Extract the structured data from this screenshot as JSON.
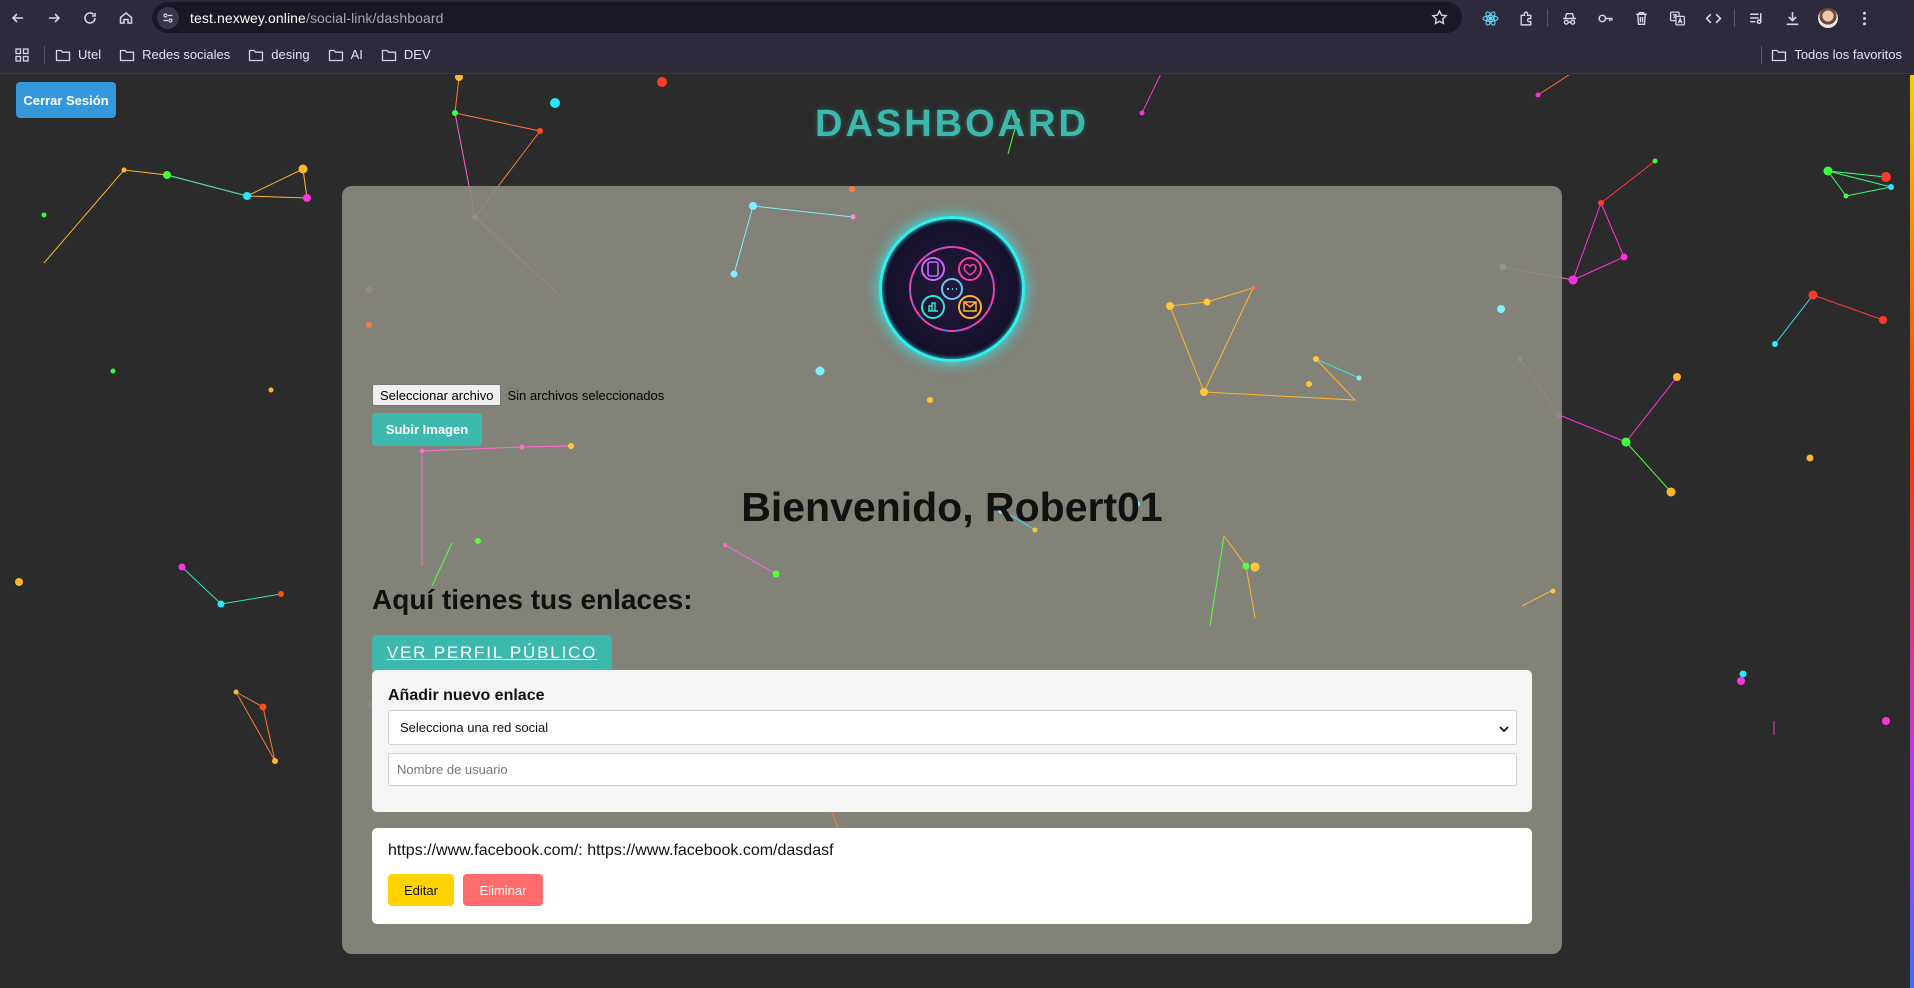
{
  "browser": {
    "url_host": "test.nexwey.online",
    "url_path": "/social-link/dashboard",
    "bookmarks": [
      "Utel",
      "Redes sociales",
      "desing",
      "AI",
      "DEV"
    ],
    "all_bookmarks_label": "Todos los favoritos"
  },
  "page": {
    "logout_label": "Cerrar Sesión",
    "title": "DASHBOARD",
    "file_button_label": "Seleccionar archivo",
    "file_status": "Sin archivos seleccionados",
    "upload_label": "Subir Imagen",
    "welcome": "Bienvenido, Robert01",
    "links_heading": "Aquí tienes tus enlaces:",
    "public_profile_label": "VER PERFIL PÚBLICO",
    "add_link": {
      "title": "Añadir nuevo enlace",
      "select_value": "Selecciona una red social",
      "username_placeholder": "Nombre de usuario"
    },
    "links": [
      {
        "text": "https://www.facebook.com/: https://www.facebook.com/dasdasf",
        "edit_label": "Editar",
        "delete_label": "Eliminar"
      }
    ]
  },
  "colors": {
    "accent": "#3cb9ac",
    "logout": "#3498db",
    "edit": "#ffd200",
    "delete": "#ff6b6b",
    "avatar_ring": "#2ef0ef"
  }
}
